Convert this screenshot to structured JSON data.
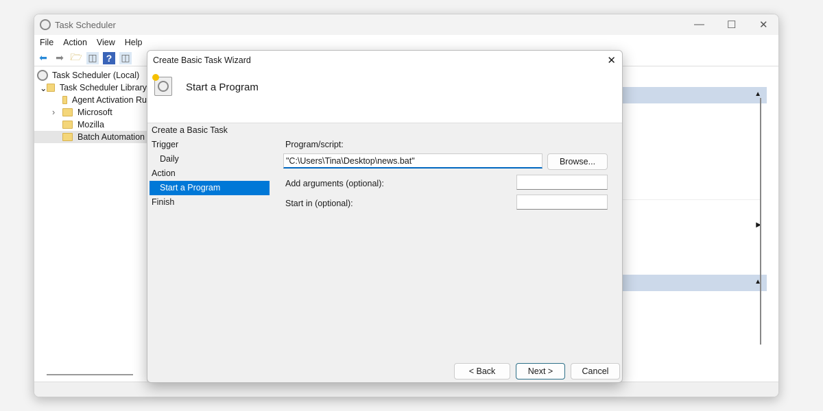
{
  "window": {
    "title": "Task Scheduler"
  },
  "menu": [
    "File",
    "Action",
    "View",
    "Help"
  ],
  "tree": {
    "root": "Task Scheduler (Local)",
    "library": "Task Scheduler Library",
    "folders": [
      "Agent Activation Ru",
      "Microsoft",
      "Mozilla",
      "Batch Automation"
    ]
  },
  "dialog": {
    "title": "Create Basic Task Wizard",
    "header": "Start a Program",
    "steps": [
      "Create a Basic Task",
      "Trigger",
      "Daily",
      "Action",
      "Start a Program",
      "Finish"
    ],
    "program_label": "Program/script:",
    "program_value": "\"C:\\Users\\Tina\\Desktop\\news.bat\"",
    "browse": "Browse...",
    "args_label": "Add arguments (optional):",
    "startin_label": "Start in (optional):",
    "back": "< Back",
    "next": "Next >",
    "cancel": "Cancel"
  },
  "colors": {
    "selection": "#0078d7",
    "section_header": "#ccd9ea"
  }
}
